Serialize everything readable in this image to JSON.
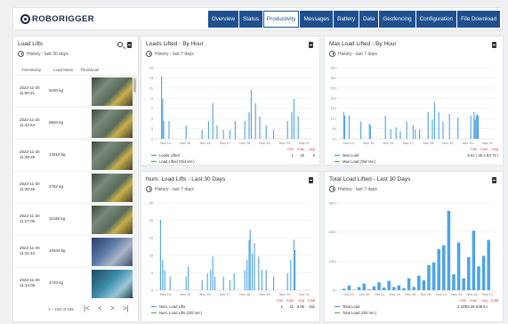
{
  "app": {
    "logo_text": "ROBORIGGER"
  },
  "nav": {
    "tabs": [
      "Overview",
      "Status",
      "Productivity",
      "Messages",
      "Battery",
      "Data",
      "Geofencing",
      "Configuration",
      "File Download"
    ],
    "active": "Productivity"
  },
  "colors": {
    "accent": "#1e4f8f",
    "bar": "#4da3e8",
    "bar2": "#7ab8ee",
    "min": "#d9534f"
  },
  "load_lifts": {
    "title": "Load Lifts",
    "history": "History - last 30 days",
    "columns": [
      "Timestamp",
      "Load Mass",
      "Thumbnail"
    ],
    "rows": [
      {
        "date": "2022-11-20",
        "time": "11:50:21",
        "load": "6160 kg",
        "thumb": "a"
      },
      {
        "date": "2022-11-20",
        "time": "11:42:54",
        "load": "9600 kg",
        "thumb": "a"
      },
      {
        "date": "2022-11-20",
        "time": "11:39:29",
        "load": "13312 kg",
        "thumb": "a"
      },
      {
        "date": "2022-11-20",
        "time": "11:38:46",
        "load": "4752 kg",
        "thumb": "a"
      },
      {
        "date": "2022-11-20",
        "time": "11:37:05",
        "load": "11446 kg",
        "thumb": "a"
      },
      {
        "date": "2022-11-20",
        "time": "11:31:42",
        "load": "10344 kg",
        "thumb": "b"
      },
      {
        "date": "2022-11-20",
        "time": "11:14:05",
        "load": "4720 kg",
        "thumb": "c"
      }
    ],
    "pager_text": "1 – 100 of 435",
    "pager_buttons": [
      "|<",
      "<",
      ">",
      ">|"
    ]
  },
  "charts": {
    "loads_by_hour": {
      "title": "Loads Lifted - By Hour",
      "history": "History - last 7 days",
      "chart_data": {
        "type": "bar",
        "x_ticks": [
          "Nov 14",
          "Nov 15",
          "Nov 16",
          "Nov 17",
          "Nov 18",
          "Nov 19",
          "Nov 20",
          "Nov 21"
        ],
        "y_ticks": [
          "15",
          "13",
          "11",
          "9",
          "7",
          "5",
          "3",
          "1"
        ],
        "ylim": [
          0,
          16
        ],
        "series": [
          {
            "name": "Loads Lifted",
            "values": [
              [
                0.15,
                14
              ],
              [
                0.2,
                9
              ],
              [
                0.25,
                4
              ],
              [
                0.5,
                4
              ],
              [
                1.3,
                3
              ],
              [
                2.05,
                2
              ],
              [
                2.35,
                4
              ],
              [
                2.55,
                8
              ],
              [
                2.75,
                3
              ],
              [
                3.05,
                2
              ],
              [
                3.35,
                2
              ],
              [
                3.6,
                4
              ],
              [
                4.05,
                4
              ],
              [
                4.25,
                6
              ],
              [
                4.35,
                11
              ],
              [
                4.55,
                8
              ],
              [
                4.75,
                5
              ],
              [
                5.05,
                3
              ],
              [
                5.4,
                2
              ],
              [
                6.05,
                4
              ],
              [
                6.25,
                6
              ],
              [
                6.35,
                9
              ],
              [
                6.55,
                5
              ]
            ]
          }
        ],
        "stats": {
          "headers": [
            "min",
            "max",
            "avg"
          ],
          "rows": [
            [
              "1",
              "15",
              "6"
            ],
            [
              "",
              "",
              ""
            ]
          ]
        },
        "legend": [
          "Loads Lifted",
          "Load Lifted (Old Ver.)"
        ]
      }
    },
    "max_load_by_hour": {
      "title": "Max Load Lifted - By Hour",
      "history": "History - last 7 days",
      "chart_data": {
        "type": "bar",
        "x_ticks": [
          "Nov 14",
          "Nov 15",
          "Nov 16",
          "Nov 17",
          "Nov 18",
          "Nov 19",
          "Nov 20",
          "Nov 21"
        ],
        "y_ticks": [
          "35 t",
          "30 t",
          "25 t",
          "20 t",
          "15 t",
          "10 t",
          "5 t",
          "0 t"
        ],
        "ylim": [
          0,
          37
        ],
        "series": [
          {
            "name": "Max Load",
            "values": [
              [
                0.1,
                14
              ],
              [
                0.15,
                12
              ],
              [
                0.35,
                12
              ],
              [
                0.9,
                9
              ],
              [
                1.3,
                8
              ],
              [
                1.35,
                7
              ],
              [
                2.05,
                12
              ],
              [
                2.3,
                5
              ],
              [
                2.55,
                6
              ],
              [
                2.75,
                4
              ],
              [
                3.05,
                9
              ],
              [
                3.35,
                7
              ],
              [
                3.45,
                5
              ],
              [
                3.65,
                5
              ],
              [
                4.05,
                14
              ],
              [
                4.25,
                10
              ],
              [
                4.35,
                19
              ],
              [
                4.55,
                14
              ],
              [
                4.75,
                9
              ],
              [
                5.05,
                13
              ],
              [
                5.45,
                11
              ],
              [
                6.05,
                12
              ],
              [
                6.2,
                14
              ],
              [
                6.25,
                10
              ],
              [
                6.3,
                12
              ],
              [
                6.35,
                13
              ],
              [
                6.4,
                12
              ]
            ]
          }
        ],
        "stats": {
          "headers": [
            "min",
            "max",
            "avg"
          ],
          "rows": [
            [
              "6.61 t",
              "36.4 t",
              "14.71 t"
            ],
            [
              "",
              "",
              ""
            ]
          ]
        },
        "legend": [
          "Max Load",
          "Max Load (Old Ver.)"
        ]
      }
    },
    "num_load_lifts_30": {
      "title": "Num. Load Lifts - Last 30 Days",
      "history": "History - last 7 days",
      "chart_data": {
        "type": "bar",
        "x_ticks": [
          "Nov 14",
          "Nov 15",
          "Nov 16",
          "Nov 17",
          "Nov 18",
          "Nov 19",
          "Nov 20",
          "Nov 21"
        ],
        "y_ticks": [
          "25",
          "20",
          "15",
          "10",
          "5",
          "0"
        ],
        "ylim": [
          0,
          26
        ],
        "series": [
          {
            "name": "Num. Load Lifts",
            "values": [
              [
                0.1,
                21
              ],
              [
                0.2,
                9
              ],
              [
                0.3,
                6
              ],
              [
                0.55,
                4
              ],
              [
                1.3,
                4
              ],
              [
                1.4,
                7
              ],
              [
                2.05,
                3
              ],
              [
                2.3,
                5
              ],
              [
                2.45,
                6
              ],
              [
                2.55,
                10
              ],
              [
                2.65,
                4
              ],
              [
                3.05,
                4
              ],
              [
                3.35,
                3
              ],
              [
                3.55,
                5
              ],
              [
                4.05,
                6
              ],
              [
                4.15,
                9
              ],
              [
                4.25,
                15
              ],
              [
                4.3,
                18
              ],
              [
                4.4,
                11
              ],
              [
                4.5,
                14
              ],
              [
                4.7,
                10
              ],
              [
                4.85,
                6
              ],
              [
                5.05,
                6
              ],
              [
                5.4,
                4
              ],
              [
                6.05,
                5
              ],
              [
                6.2,
                9
              ],
              [
                6.35,
                15
              ],
              [
                6.4,
                12
              ]
            ]
          }
        ],
        "stats": {
          "headers": [
            "min",
            "max",
            "avg",
            "total"
          ],
          "rows": [
            [
              "1",
              "21",
              "8.05",
              "161"
            ],
            [
              "",
              "",
              "",
              ""
            ]
          ]
        },
        "legend": [
          "Num. Load Lifts",
          "Num. Load Lifts (Old Ver.)"
        ]
      }
    },
    "total_load_30": {
      "title": "Total Load Lifted - Last 30 Days",
      "history": "History - last 7 days",
      "chart_data": {
        "type": "bar",
        "x_ticks": [
          "Oct 23",
          "Oct 28",
          "Oct 31",
          "Nov 03",
          "Nov 06",
          "Nov 09",
          "Nov 12",
          "Nov 15",
          "Nov 18",
          "Nov 21"
        ],
        "y_ticks": [
          "300 t",
          "200 t",
          "100 t",
          "0 t"
        ],
        "ylim": [
          0,
          330
        ],
        "series": [
          {
            "name": "Total Load",
            "values": [
              [
                0,
                5
              ],
              [
                1,
                18
              ],
              [
                2,
                2
              ],
              [
                3,
                12
              ],
              [
                4,
                25
              ],
              [
                5,
                3
              ],
              [
                6,
                15
              ],
              [
                7,
                30
              ],
              [
                8,
                10
              ],
              [
                9,
                35
              ],
              [
                10,
                12
              ],
              [
                11,
                18
              ],
              [
                12,
                8
              ],
              [
                13,
                45
              ],
              [
                14,
                12
              ],
              [
                15,
                55
              ],
              [
                16,
                38
              ],
              [
                17,
                95
              ],
              [
                18,
                105
              ],
              [
                19,
                155
              ],
              [
                20,
                170
              ],
              [
                21,
                300
              ],
              [
                22,
                60
              ],
              [
                23,
                180
              ],
              [
                24,
                45
              ],
              [
                25,
                125
              ],
              [
                26,
                225
              ],
              [
                27,
                90
              ],
              [
                28,
                130
              ],
              [
                29,
                190
              ]
            ]
          }
        ],
        "stats": {
          "headers": [
            "min",
            "max",
            "avg",
            "total"
          ],
          "rows": [
            [
              "2.11 t",
              "722.86 t",
              "148.5 t",
              ""
            ],
            [
              "",
              "",
              "",
              ""
            ]
          ]
        },
        "legend": [
          "Total Load",
          "Total Load (Old Ver.)"
        ]
      }
    }
  }
}
